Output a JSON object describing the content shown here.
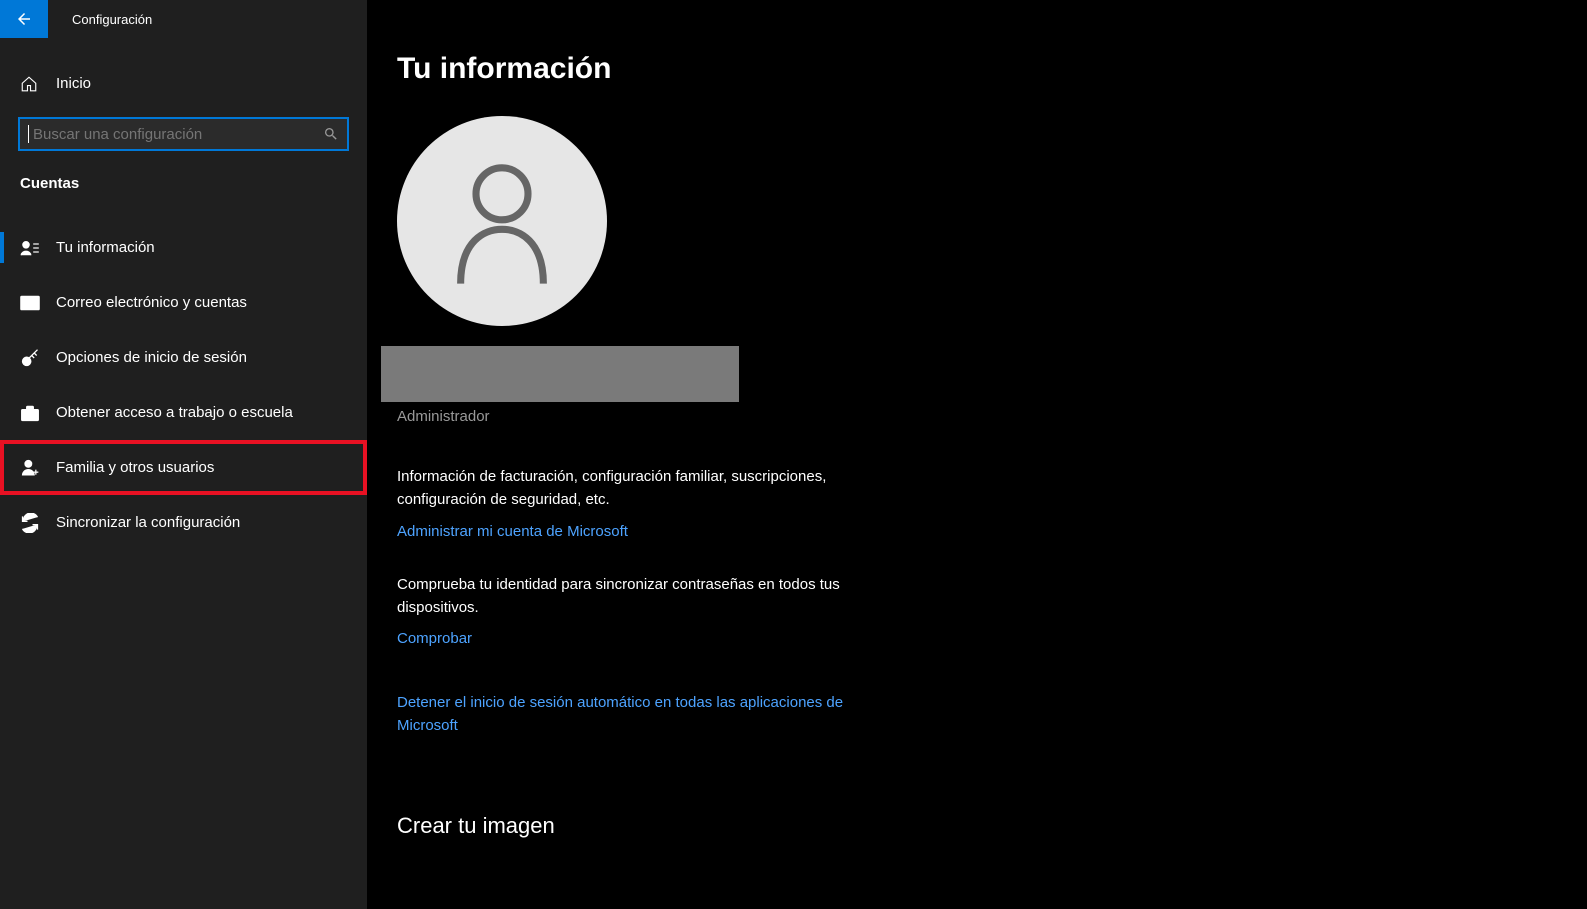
{
  "titlebar": {
    "title": "Configuración"
  },
  "sidebar": {
    "home": "Inicio",
    "search_placeholder": "Buscar una configuración",
    "section": "Cuentas",
    "items": [
      {
        "label": "Tu información",
        "icon": "person-detail-icon",
        "active": true
      },
      {
        "label": "Correo electrónico y cuentas",
        "icon": "mail-icon"
      },
      {
        "label": "Opciones de inicio de sesión",
        "icon": "key-icon"
      },
      {
        "label": "Obtener acceso a trabajo o escuela",
        "icon": "briefcase-icon"
      },
      {
        "label": "Familia y otros usuarios",
        "icon": "person-add-icon",
        "highlighted": true
      },
      {
        "label": "Sincronizar la configuración",
        "icon": "sync-icon"
      }
    ]
  },
  "main": {
    "page_title": "Tu información",
    "role": "Administrador",
    "billing_info": "Información de facturación, configuración familiar, suscripciones, configuración de seguridad, etc.",
    "manage_link": "Administrar mi cuenta de Microsoft",
    "verify_info": "Comprueba tu identidad para sincronizar contraseñas en todos tus dispositivos.",
    "verify_link": "Comprobar",
    "stop_auto_signin": "Detener el inicio de sesión automático en todas las aplicaciones de Microsoft",
    "create_image": "Crear tu imagen"
  }
}
